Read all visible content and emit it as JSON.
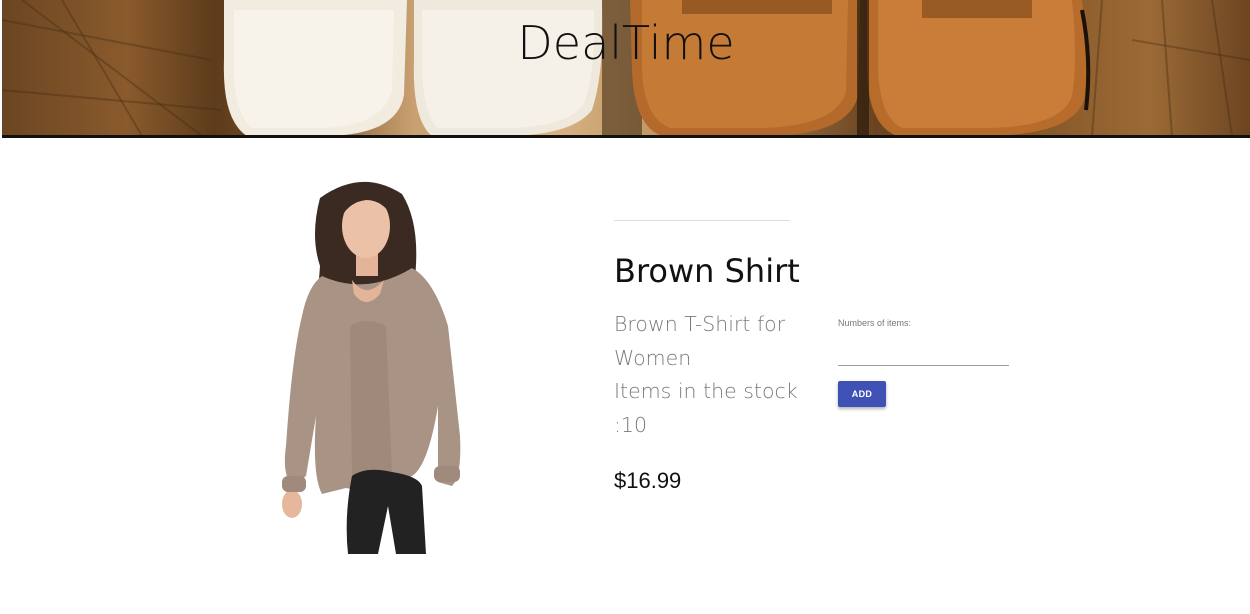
{
  "header": {
    "site_title": "DealTime"
  },
  "product": {
    "name": "Brown Shirt",
    "description_line1": "Brown T-Shirt for",
    "description_line2": "Women",
    "stock_line1": "Items in the stock",
    "stock_line2": ":10",
    "stock_count": 10,
    "price": "$16.99"
  },
  "cart_form": {
    "quantity_label": "Numbers of items:",
    "quantity_value": "",
    "quantity_placeholder": "",
    "add_label": "ADD"
  },
  "colors": {
    "accent": "#3f51b5",
    "header_border": "#111111",
    "muted_text": "#7a7a7a"
  }
}
